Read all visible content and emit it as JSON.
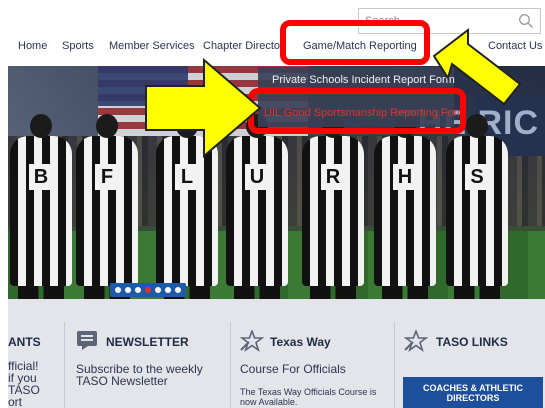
{
  "search": {
    "placeholder": "Search"
  },
  "nav": {
    "items": [
      "Home",
      "Sports",
      "Member Services",
      "Chapter Directory",
      "Game/Match Reporting",
      "Contact Us"
    ]
  },
  "dropdown": {
    "items": [
      "Private Schools Incident Report Form",
      "UIL Good Sportsmanship Reporting Form"
    ]
  },
  "hero": {
    "letters": [
      "B",
      "F",
      "L",
      "U",
      "R",
      "H",
      "S"
    ],
    "sign_text": "THE RIC",
    "slides_total": 7,
    "active_slide": 4
  },
  "panel": {
    "col1": {
      "title": "ANTS",
      "lines": [
        "fficial!",
        "if you",
        "TASO",
        "ort"
      ]
    },
    "col2": {
      "title": "NEWSLETTER",
      "lines": [
        "Subscribe to the weekly",
        "TASO Newsletter"
      ]
    },
    "col3": {
      "title": "Texas Way",
      "subtitle": "Course For Officials",
      "lines": [
        "The Texas Way Officials Course is",
        "now Available."
      ]
    },
    "col4": {
      "title": "TASO LINKS",
      "button": [
        "COACHES & ATHLETIC",
        "DIRECTORS"
      ]
    }
  },
  "annotations": {
    "highlight_color": "#ff0000",
    "arrow_color": "#ffff00"
  }
}
